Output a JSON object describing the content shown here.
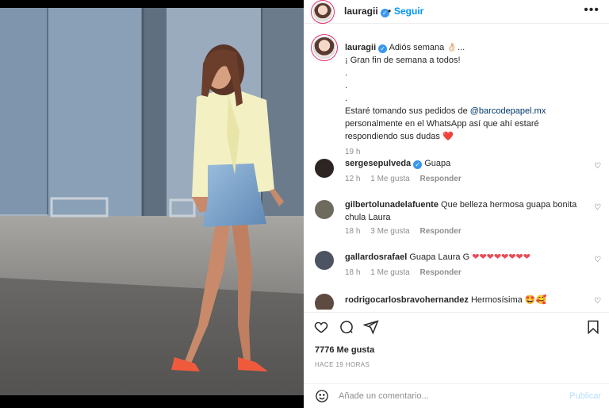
{
  "header": {
    "username": "lauragii",
    "separator": "•",
    "follow_label": "Seguir",
    "more_icon": "more-horizontal-icon"
  },
  "caption": {
    "username": "lauragii",
    "line1": "Adiós semana 👌🏻...",
    "line2": "¡ Gran fin de semana a todos!",
    "dot1": ".",
    "dot2": ".",
    "dot3": ".",
    "text_before_mention": "Estaré tomando sus pedidos de ",
    "mention": "@barcodepapel.mx",
    "text_after_mention": "personalmente en el WhatsApp así que ahí estaré respondiendo sus dudas",
    "heart": "❤️",
    "time": "19 h"
  },
  "comments": [
    {
      "username": "sergesepulveda",
      "verified": true,
      "text": "Guapa",
      "time": "12 h",
      "likes": "1 Me gusta",
      "reply": "Responder"
    },
    {
      "username": "gilbertolunadelafuente",
      "verified": false,
      "text": "Que belleza hermosa guapa bonita chula Laura",
      "time": "18 h",
      "likes": "3 Me gusta",
      "reply": "Responder"
    },
    {
      "username": "gallardosrafael",
      "verified": false,
      "text": "Guapa Laura G",
      "hearts": "❤❤❤❤❤❤❤❤",
      "time": "18 h",
      "likes": "1 Me gusta",
      "reply": "Responder"
    },
    {
      "username": "rodrigocarlosbravohernandez",
      "verified": false,
      "text": "Hermosísima 🤩🥰"
    }
  ],
  "likes_count": "7776 Me gusta",
  "posted_ago": "HACE 19 HORAS",
  "add_comment": {
    "placeholder": "Añade un comentario...",
    "post_label": "Publicar"
  },
  "colors": {
    "accent_blue": "#0095f6",
    "verified_blue": "#3897f0",
    "heart_red": "#ed4956",
    "muted_gray": "#8e8e8e"
  }
}
